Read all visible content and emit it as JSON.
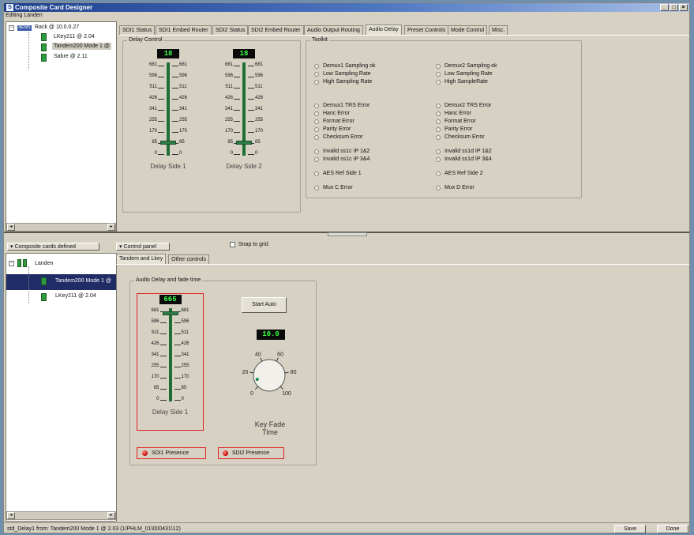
{
  "app": {
    "title": "Composite Card Designer",
    "editing": "Editing Landen",
    "window_controls": [
      "_",
      "□",
      "×"
    ]
  },
  "tree_top": {
    "items": [
      "Rack @ 10.0.0.27",
      "LKey211 @ 2.04",
      "Tandem200 Mode 1 @",
      "Sabre @ 2.11"
    ],
    "badge": "NEWS"
  },
  "tabs_top": [
    "SDI1 Status",
    "SDI1 Embed Router",
    "SDI2 Status",
    "SDI2 Embed Router",
    "Audio Output Routing",
    "Audio Delay",
    "Preset Controls",
    "Mode Control",
    "Misc."
  ],
  "delay_control": {
    "title": "Delay Control",
    "sliders": [
      {
        "display": "18",
        "label": "Delay Side 1",
        "value": 85
      },
      {
        "display": "18",
        "label": "Delay Side 2",
        "value": 85
      }
    ],
    "ticks": [
      "681",
      "596",
      "511",
      "426",
      "341",
      "255",
      "170",
      "85",
      "0"
    ]
  },
  "toolkit": {
    "title": "Toolkit",
    "col1": [
      "Demux1 Sampling ok",
      "Low Sampling Rate",
      "High Sampling Rate",
      "Demux1 TRS Error",
      "Hanc Error",
      "Format Error",
      "Parity Error",
      "Checksum Error",
      "Invalid ss1c IP 1&2",
      "Invalid ss1c IP 3&4",
      "AES Ref Side 1",
      "Mux C Error"
    ],
    "col2": [
      "Demux2 Sampling ok",
      "Low Sampling Rate",
      "High SampleRate",
      "Demux2 TRS Error",
      "Hanc Error",
      "Format Error",
      "Parity Error",
      "Checksum Error",
      "Invalid ss1d IP 1&2",
      "Invalid ss1d IP 3&4",
      "AES Ref Side 2",
      "Mux D Error"
    ]
  },
  "left_bottom": {
    "dropdown": "Composite cards defined",
    "items": [
      "Landen",
      "Tandem200 Mode 1 @",
      "LKey211 @ 2.04"
    ]
  },
  "control_panel": {
    "dropdown": "Control panel",
    "snap_label": "Snap to grid",
    "tabs": [
      "Tandem and Lkey",
      "Other controls"
    ]
  },
  "audio_delay": {
    "title": "Audio Delay and fade time",
    "display": "665",
    "slider_label": "Delay Side 1",
    "slider_value": 665,
    "start_auto": "Start Auto",
    "fade_display": "10.0",
    "knob_value": 10.0,
    "knob_ticks": [
      "0",
      "20",
      "40",
      "60",
      "80",
      "100"
    ],
    "knob_label": "Key Fade Time",
    "presence1": "SDI1 Presence",
    "presence2": "SDI2 Presence"
  },
  "status": {
    "text": "std_Delay1 from: Tandem200 Mode 1 @ 2.03 (1/PHLM_01\\000431\\12)",
    "save": "Save",
    "done": "Done"
  }
}
